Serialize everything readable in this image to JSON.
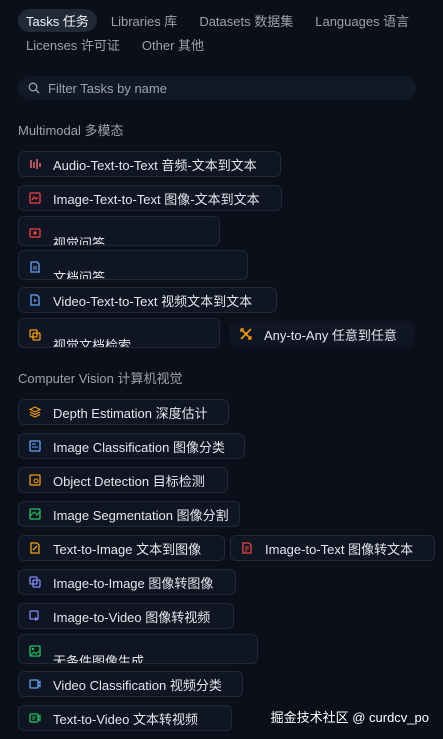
{
  "tabs": {
    "row1": [
      {
        "label": "Tasks 任务",
        "active": true
      },
      {
        "label": "Libraries 库",
        "active": false
      },
      {
        "label": "Datasets 数据集",
        "active": false
      },
      {
        "label": "Languages 语言",
        "active": false
      }
    ],
    "row2": [
      {
        "label": "Licenses 许可证",
        "active": false
      },
      {
        "label": "Other 其他",
        "active": false
      }
    ]
  },
  "search": {
    "placeholder": "Filter Tasks by name"
  },
  "sections": {
    "multimodal": {
      "title": "Multimodal 多模态",
      "items": [
        {
          "label": "Audio-Text-to-Text 音频-文本到文本",
          "icon": "audio-text-icon",
          "color": "#f87171"
        },
        {
          "label": "Image-Text-to-Text 图像-文本到文本",
          "icon": "image-text-icon",
          "color": "#ef4444"
        },
        {
          "label": "视觉问答",
          "icon": "visual-qa-icon",
          "color": "#ef4444"
        },
        {
          "label": "文档问答",
          "icon": "document-qa-icon",
          "color": "#60a5fa"
        },
        {
          "label": "Video-Text-to-Text 视频文本到文本",
          "icon": "video-text-icon",
          "color": "#60a5fa"
        },
        {
          "label": "视觉文档检索",
          "icon": "visual-doc-retrieval-icon",
          "color": "#f59e0b"
        },
        {
          "label": "Any-to-Any 任意到任意",
          "icon": "any-to-any-icon",
          "color": "#f59e0b"
        }
      ]
    },
    "cv": {
      "title": "Computer Vision 计算机视觉",
      "items": [
        {
          "label": "Depth Estimation 深度估计",
          "icon": "depth-estimation-icon",
          "color": "#f59e0b"
        },
        {
          "label": "Image Classification 图像分类",
          "icon": "image-classification-icon",
          "color": "#60a5fa"
        },
        {
          "label": "Object Detection 目标检测",
          "icon": "object-detection-icon",
          "color": "#f59e0b"
        },
        {
          "label": "Image Segmentation 图像分割",
          "icon": "image-segmentation-icon",
          "color": "#22c55e"
        },
        {
          "label": "Text-to-Image 文本到图像",
          "icon": "text-to-image-icon",
          "color": "#f59e0b"
        },
        {
          "label": "Image-to-Text 图像转文本",
          "icon": "image-to-text-icon",
          "color": "#ef4444"
        },
        {
          "label": "Image-to-Image 图像转图像",
          "icon": "image-to-image-icon",
          "color": "#818cf8"
        },
        {
          "label": "Image-to-Video 图像转视频",
          "icon": "image-to-video-icon",
          "color": "#818cf8"
        },
        {
          "label": "无条件图像生成",
          "icon": "unconditional-image-gen-icon",
          "color": "#22c55e"
        },
        {
          "label": "Video Classification 视频分类",
          "icon": "video-classification-icon",
          "color": "#60a5fa"
        },
        {
          "label": "Text-to-Video 文本转视频",
          "icon": "text-to-video-icon",
          "color": "#22c55e"
        }
      ]
    }
  },
  "watermark": "掘金技术社区 @ curdcv_po"
}
